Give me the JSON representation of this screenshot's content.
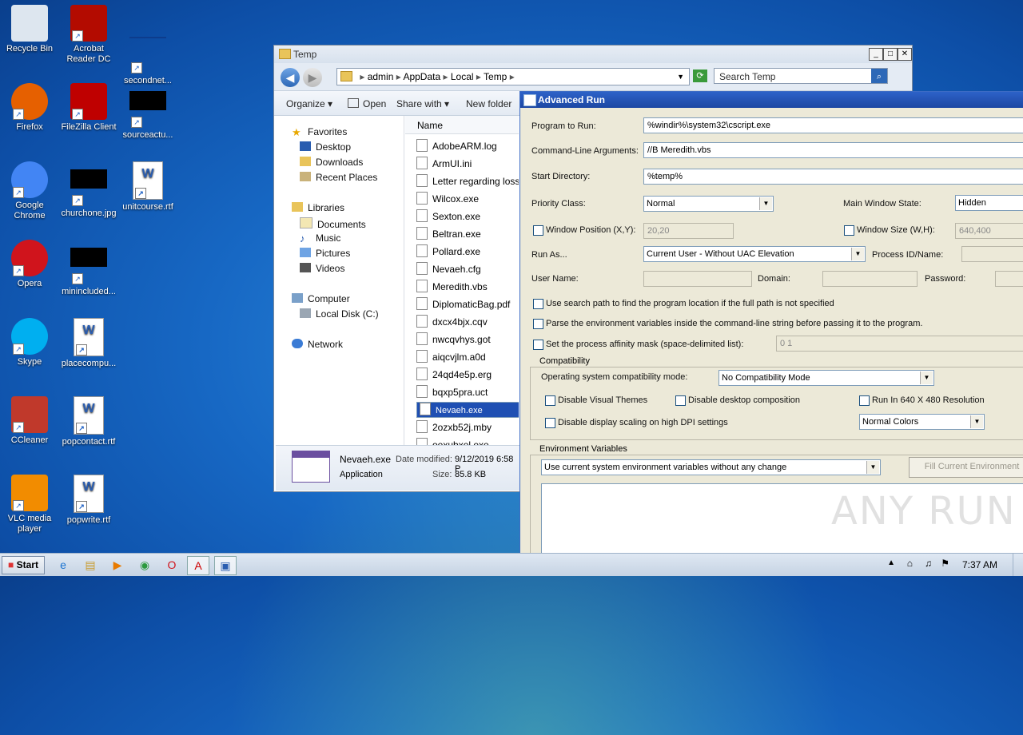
{
  "desktop": {
    "icons": [
      {
        "label": "Recycle Bin",
        "icon": "recycle-bin-icon"
      },
      {
        "label": "Acrobat Reader DC",
        "icon": "acrobat-icon"
      },
      {
        "label": "secondnet...",
        "icon": "file-icon"
      },
      {
        "label": "Firefox",
        "icon": "firefox-icon"
      },
      {
        "label": "FileZilla Client",
        "icon": "filezilla-icon"
      },
      {
        "label": "sourceactu...",
        "icon": "file-icon"
      },
      {
        "label": "Google Chrome",
        "icon": "chrome-icon"
      },
      {
        "label": "churchone.jpg",
        "icon": "image-file-icon"
      },
      {
        "label": "unitcourse.rtf",
        "icon": "word-doc-icon"
      },
      {
        "label": "Opera",
        "icon": "opera-icon"
      },
      {
        "label": "minincluded...",
        "icon": "file-icon"
      },
      {
        "label": "Skype",
        "icon": "skype-icon"
      },
      {
        "label": "placecompu...",
        "icon": "word-doc-icon"
      },
      {
        "label": "CCleaner",
        "icon": "ccleaner-icon"
      },
      {
        "label": "popcontact.rtf",
        "icon": "word-doc-icon"
      },
      {
        "label": "VLC media player",
        "icon": "vlc-icon"
      },
      {
        "label": "popwrite.rtf",
        "icon": "word-doc-icon"
      }
    ]
  },
  "explorer": {
    "title": "Temp",
    "breadcrumb": [
      "admin",
      "AppData",
      "Local",
      "Temp"
    ],
    "search_placeholder": "Search Temp",
    "toolbar": {
      "organize": "Organize",
      "open": "Open",
      "share_with": "Share with",
      "new_folder": "New folder"
    },
    "nav": {
      "favorites": "Favorites",
      "desktop": "Desktop",
      "downloads": "Downloads",
      "recent": "Recent Places",
      "libraries": "Libraries",
      "documents": "Documents",
      "music": "Music",
      "pictures": "Pictures",
      "videos": "Videos",
      "computer": "Computer",
      "local_disk": "Local Disk (C:)",
      "network": "Network"
    },
    "column_name": "Name",
    "files": [
      "AdobeARM.log",
      "ArmUI.ini",
      "Letter regarding loss o",
      "Wilcox.exe",
      "Sexton.exe",
      "Beltran.exe",
      "Pollard.exe",
      "Nevaeh.cfg",
      "Meredith.vbs",
      "DiplomaticBag.pdf",
      "dxcx4bjx.cqv",
      "nwcqvhys.got",
      "aiqcvjlm.a0d",
      "24qd4e5p.erg",
      "bqxp5pra.uct",
      "Nevaeh.exe",
      "2ozxb52j.mby",
      "oexubxel.exe"
    ],
    "selected_file": "Nevaeh.exe",
    "details": {
      "name": "Nevaeh.exe",
      "modified_label": "Date modified:",
      "modified": "9/12/2019 6:58 P",
      "type": "Application",
      "size_label": "Size:",
      "size": "85.8 KB"
    }
  },
  "advanced_run": {
    "title": "Advanced Run",
    "program_label": "Program to Run:",
    "program_value": "%windir%\\system32\\cscript.exe",
    "args_label": "Command-Line Arguments:",
    "args_value": "//B Meredith.vbs",
    "startdir_label": "Start Directory:",
    "startdir_value": "%temp%",
    "priority_label": "Priority Class:",
    "priority_value": "Normal",
    "mainwin_label": "Main Window State:",
    "mainwin_value": "Hidden",
    "winpos_label": "Window Position (X,Y):",
    "winpos_value": "20,20",
    "winsize_label": "Window Size (W,H):",
    "winsize_value": "640,400",
    "runas_label": "Run As...",
    "runas_value": "Current User - Without UAC Elevation",
    "pid_label": "Process ID/Name:",
    "username_label": "User Name:",
    "domain_label": "Domain:",
    "password_label": "Password:",
    "opt_search_path": "Use search path to find the program location if the full path is not specified",
    "opt_parse_env": "Parse the environment variables inside the command-line string before passing it to the program.",
    "opt_affinity": "Set the process affinity mask (space-delimited list):",
    "affinity_value": "0 1",
    "compat_group": "Compatibility",
    "compat_mode_label": "Operating system compatibility mode:",
    "compat_mode_value": "No Compatibility Mode",
    "disable_themes": "Disable Visual Themes",
    "disable_desktop_comp": "Disable desktop composition",
    "run_640": "Run In 640 X 480 Resolution",
    "disable_dpi": "Disable display scaling on high DPI settings",
    "colors_value": "Normal Colors",
    "env_group": "Environment Variables",
    "env_mode_value": "Use current system environment variables without any change",
    "fill_env_button": "Fill Current Environment"
  },
  "taskbar": {
    "start": "Start",
    "clock": "7:37 AM"
  },
  "watermark": "ANY RUN"
}
